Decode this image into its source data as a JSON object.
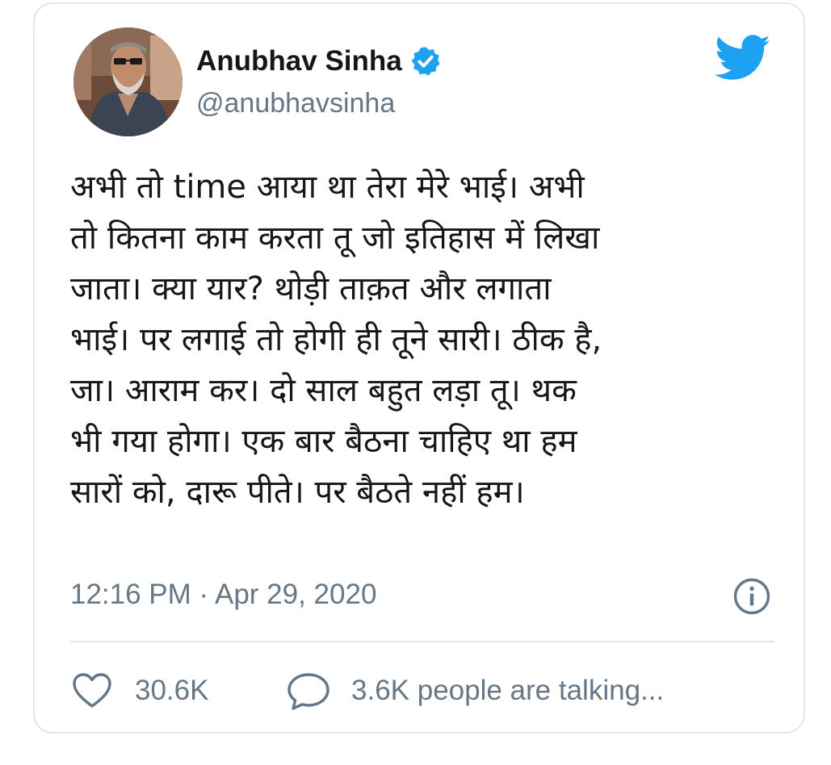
{
  "author": {
    "display_name": "Anubhav Sinha",
    "handle": "@anubhavsinha",
    "verified": true
  },
  "tweet": {
    "text": "अभी तो time आया था तेरा मेरे भाई। अभी\nतो कितना काम करता तू जो इतिहास में लिखा\nजाता। क्या यार? थोड़ी ताक़त और लगाता\nभाई। पर लगाई तो होगी ही तूने सारी। ठीक है,\nजा। आराम कर। दो साल बहुत लड़ा तू। थक\nभी गया होगा। एक बार बैठना चाहिए था हम\nसारों को, दारू पीते। पर बैठते नहीं हम।",
    "timestamp": "12:16 PM · Apr 29, 2020"
  },
  "actions": {
    "likes": "30.6K",
    "talking": "3.6K people are talking..."
  },
  "icons": {
    "brand": "twitter-bird-icon",
    "verified": "verified-badge-icon",
    "info": "info-icon",
    "like": "heart-icon",
    "reply": "speech-bubble-icon"
  },
  "colors": {
    "twitter_blue": "#1da1f2",
    "text_primary": "#14171a",
    "text_secondary": "#657786",
    "border": "#e1e8ed"
  }
}
